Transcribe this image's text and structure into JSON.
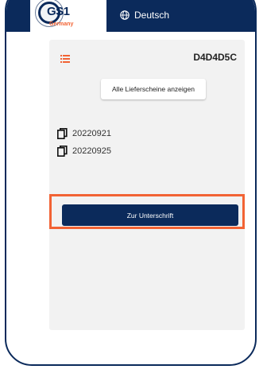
{
  "header": {
    "logo_text": "GS1",
    "logo_subtext": "Germany",
    "language_label": "Deutsch",
    "colors": {
      "primary": "#0b2a5b",
      "accent": "#f26334"
    }
  },
  "panel": {
    "menu_icon": "list-icon",
    "document_id": "D4D4D5C",
    "show_all_button": "Alle Lieferscheine anzeigen",
    "documents": [
      {
        "icon": "copy-icon",
        "label": "20220921"
      },
      {
        "icon": "copy-icon",
        "label": "20220925"
      }
    ],
    "sign_button": "Zur Unterschrift"
  }
}
